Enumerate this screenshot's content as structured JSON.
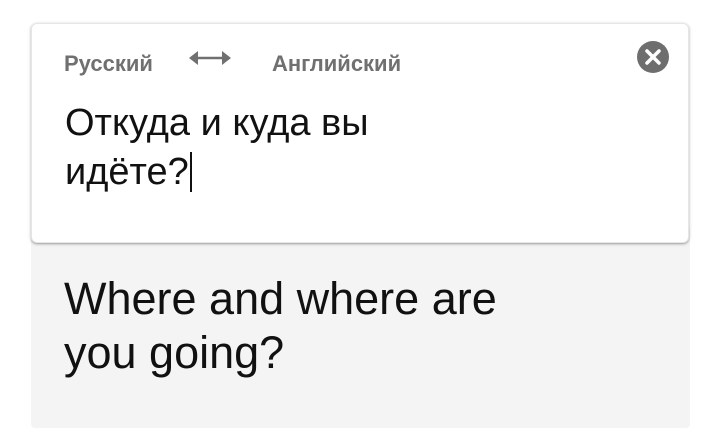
{
  "languages": {
    "source": "Русский",
    "target": "Английский"
  },
  "icons": {
    "swap": "swap-arrows-icon",
    "clear": "close-icon"
  },
  "input": {
    "line1": "Откуда и куда вы",
    "line2": "идёте?"
  },
  "output": {
    "line1": "Where and where are",
    "line2": "you going?"
  },
  "colors": {
    "lang_label": "#707070",
    "close_icon": "#6e6e6e",
    "output_background": "#f4f4f4",
    "text": "#111111"
  }
}
